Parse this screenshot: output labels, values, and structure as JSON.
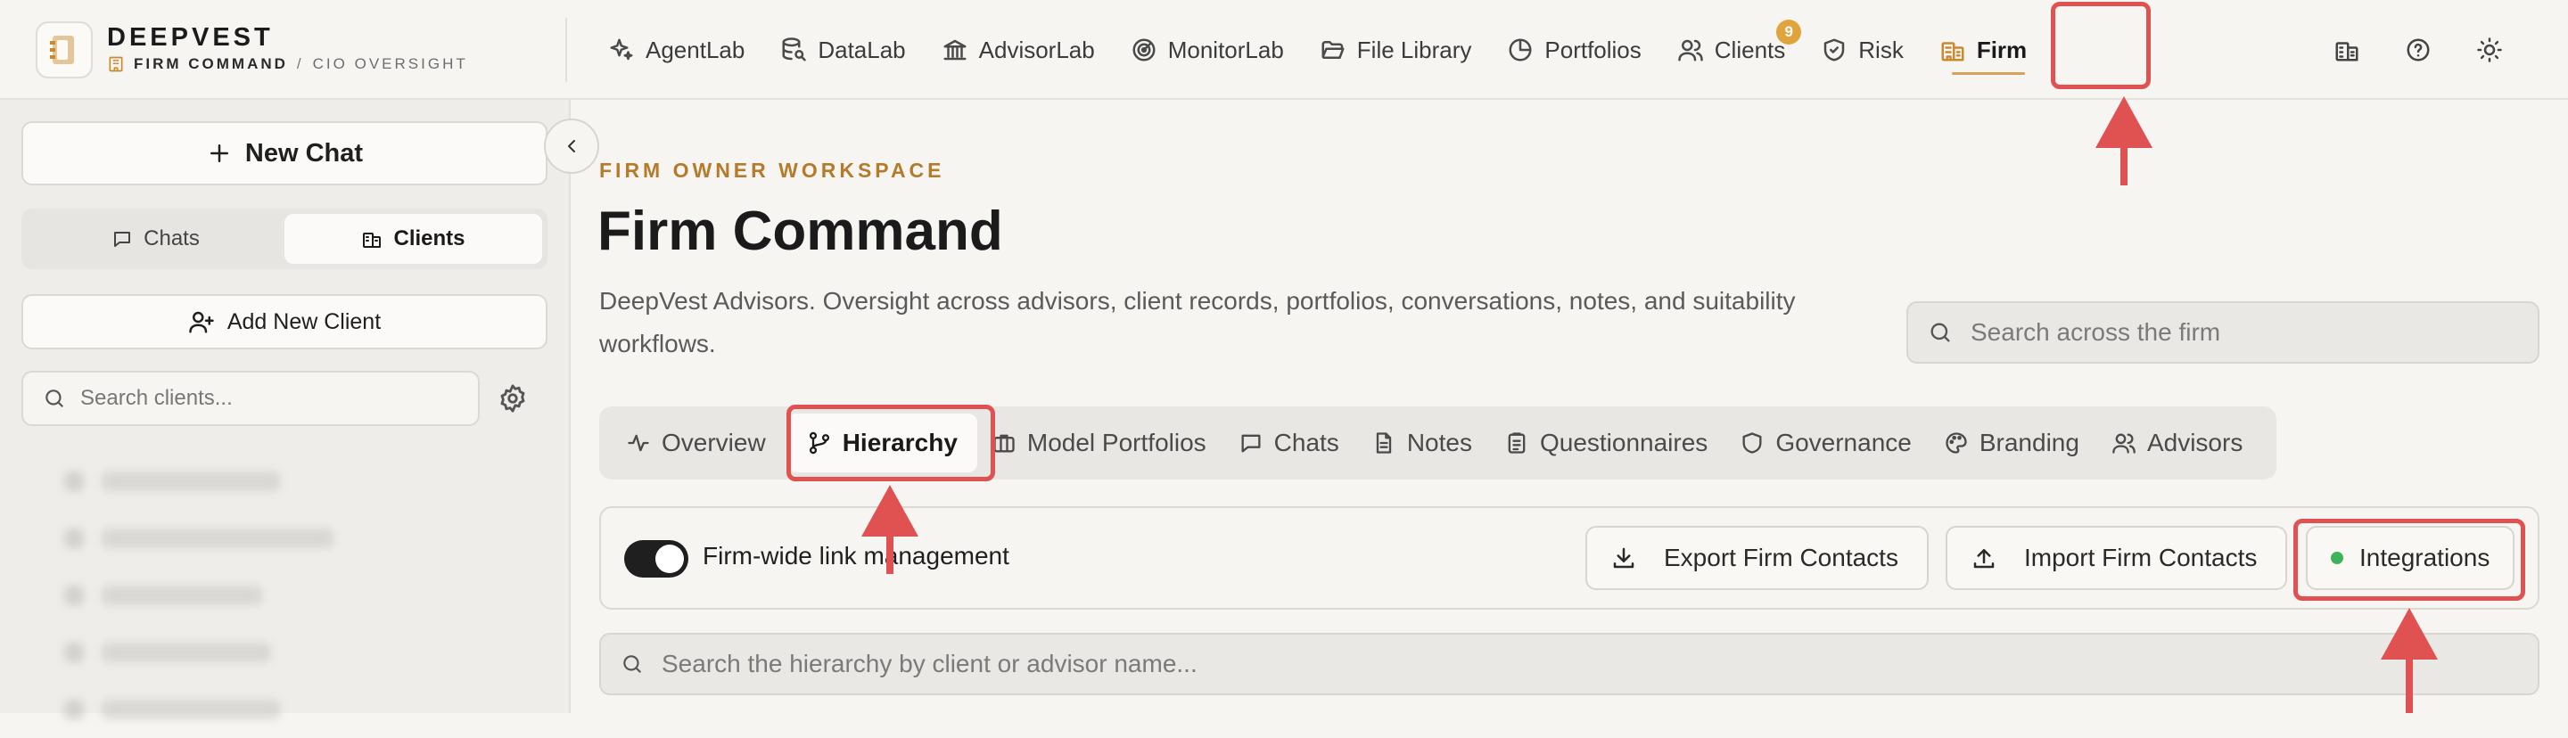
{
  "brand": {
    "name": "DEEPVEST",
    "section": "FIRM COMMAND",
    "separator": "/",
    "mode": "CIO OVERSIGHT"
  },
  "nav": {
    "items": [
      {
        "label": "AgentLab",
        "icon": "sparkles-icon"
      },
      {
        "label": "DataLab",
        "icon": "database-search-icon"
      },
      {
        "label": "AdvisorLab",
        "icon": "bank-icon"
      },
      {
        "label": "MonitorLab",
        "icon": "radar-icon"
      },
      {
        "label": "File Library",
        "icon": "folder-open-icon"
      },
      {
        "label": "Portfolios",
        "icon": "pie-chart-icon"
      },
      {
        "label": "Clients",
        "icon": "users-icon",
        "badge": "9"
      },
      {
        "label": "Risk",
        "icon": "shield-check-icon"
      },
      {
        "label": "Firm",
        "icon": "building-icon",
        "active": true
      }
    ],
    "right_icons": [
      "building-icon",
      "help-icon",
      "sun-icon"
    ]
  },
  "sidebar": {
    "new_chat": "New Chat",
    "tabs": [
      {
        "label": "Chats"
      },
      {
        "label": "Clients",
        "active": true
      }
    ],
    "add_client": "Add New Client",
    "search_placeholder": "Search clients..."
  },
  "main": {
    "eyebrow": "FIRM OWNER WORKSPACE",
    "title": "Firm Command",
    "description": "DeepVest Advisors. Oversight across advisors, client records, portfolios, conversations, notes, and suitability workflows.",
    "search_placeholder": "Search across the firm",
    "tabs": [
      {
        "label": "Overview"
      },
      {
        "label": "Hierarchy",
        "active": true
      },
      {
        "label": "Model Portfolios"
      },
      {
        "label": "Chats"
      },
      {
        "label": "Notes"
      },
      {
        "label": "Questionnaires"
      },
      {
        "label": "Governance"
      },
      {
        "label": "Branding"
      },
      {
        "label": "Advisors"
      }
    ],
    "toolbar": {
      "toggle_label": "Firm-wide link management",
      "toggle_on": true,
      "export_label": "Export Firm Contacts",
      "import_label": "Import Firm Contacts",
      "integrations_label": "Integrations",
      "integrations_status_color": "#3fb35a"
    },
    "hierarchy_search_placeholder": "Search the hierarchy by client or advisor name..."
  },
  "colors": {
    "accent": "#c98a2e",
    "annotation": "#e05252",
    "badge": "#e0a43c"
  }
}
